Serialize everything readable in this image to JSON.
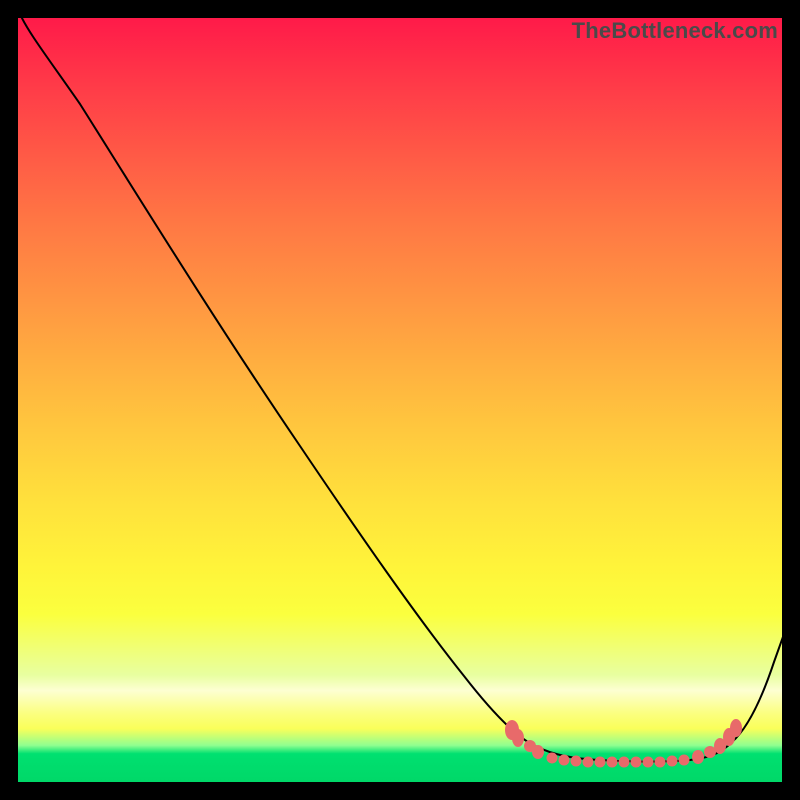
{
  "watermark": "TheBottleneck.com",
  "chart_data": {
    "type": "line",
    "title": "",
    "xlabel": "",
    "ylabel": "",
    "xlim": [
      0,
      100
    ],
    "ylim": [
      0,
      100
    ],
    "grid": false,
    "legend": false,
    "series": [
      {
        "name": "bottleneck-curve",
        "x": [
          0,
          2,
          4,
          7,
          12,
          18,
          25,
          32,
          40,
          48,
          55,
          60,
          64,
          67,
          70,
          73,
          76,
          79,
          82,
          85,
          88,
          91,
          94,
          97,
          100
        ],
        "y": [
          100,
          99.5,
          99,
          98,
          95,
          89,
          80,
          70,
          58.5,
          47,
          37,
          30,
          24,
          19,
          14,
          10,
          7,
          4.8,
          3.4,
          3,
          3,
          3.2,
          4.6,
          10,
          23
        ]
      }
    ],
    "annotations": {
      "bead_region_x": [
        64,
        88
      ],
      "bead_region_y": [
        2.5,
        6
      ]
    },
    "background_gradient": {
      "stops": [
        {
          "pos": 0.0,
          "color": "#ff1a49"
        },
        {
          "pos": 0.5,
          "color": "#ffc040"
        },
        {
          "pos": 0.8,
          "color": "#fbff50"
        },
        {
          "pos": 0.96,
          "color": "#00e070"
        },
        {
          "pos": 1.0,
          "color": "#00d868"
        }
      ]
    }
  }
}
